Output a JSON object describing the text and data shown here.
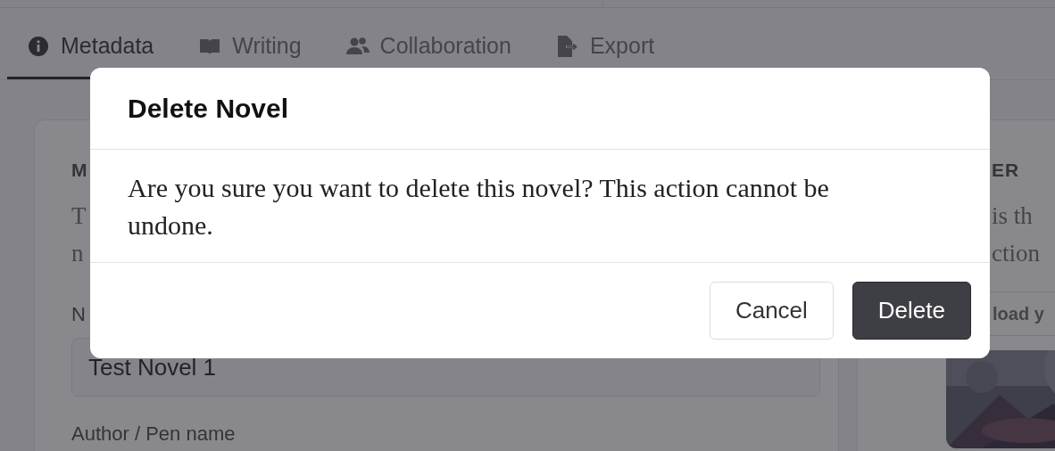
{
  "tabs": [
    {
      "label": "Metadata",
      "selected": true
    },
    {
      "label": "Writing",
      "selected": false
    },
    {
      "label": "Collaboration",
      "selected": false
    },
    {
      "label": "Export",
      "selected": false
    }
  ],
  "left_card": {
    "heading": "M",
    "description_lines": [
      "T",
      "n"
    ],
    "field_label": "N",
    "name_field": {
      "value": "Test Novel 1"
    },
    "author_label": "Author / Pen name"
  },
  "right_card": {
    "heading": "ER",
    "description_lines": [
      "is th",
      "ction"
    ],
    "upload_field": {
      "placeholder": "load y"
    }
  },
  "dialog": {
    "title": "Delete Novel",
    "message": "Are you sure you want to delete this novel? This action cannot be undone.",
    "buttons": [
      {
        "label": "Cancel",
        "kind": "secondary"
      },
      {
        "label": "Delete",
        "kind": "primary"
      }
    ]
  }
}
